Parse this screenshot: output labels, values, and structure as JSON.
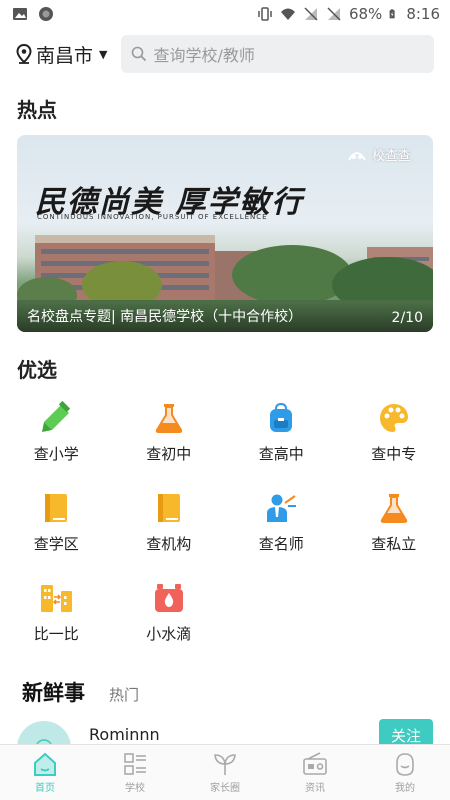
{
  "status": {
    "battery": "68%",
    "time": "8:16"
  },
  "location": {
    "city": "南昌市"
  },
  "search": {
    "placeholder": "查询学校/教师"
  },
  "hot": {
    "title": "热点",
    "banner": {
      "brand": "校查查",
      "calligraphy": "民德尚美 厚学敏行",
      "motto": "CONTINUOUS INNOVATION, PURSUIT OF EXCELLENCE",
      "caption": "名校盘点专题| 南昌民德学校（十中合作校）",
      "pager": "2/10"
    }
  },
  "featured": {
    "title": "优选",
    "items": [
      {
        "label": "查小学",
        "icon": "pencil-icon"
      },
      {
        "label": "查初中",
        "icon": "flask-icon"
      },
      {
        "label": "查高中",
        "icon": "backpack-icon"
      },
      {
        "label": "查中专",
        "icon": "palette-icon"
      },
      {
        "label": "查学区",
        "icon": "book-icon"
      },
      {
        "label": "查机构",
        "icon": "book-icon"
      },
      {
        "label": "查名师",
        "icon": "teacher-icon"
      },
      {
        "label": "查私立",
        "icon": "flask-icon"
      },
      {
        "label": "比一比",
        "icon": "compare-icon"
      },
      {
        "label": "小水滴",
        "icon": "water-drop-icon"
      }
    ]
  },
  "news": {
    "title": "新鲜事",
    "tab_hot": "热门",
    "post": {
      "user": "Rominnn",
      "follow_label": "关注"
    }
  },
  "tabs": [
    {
      "label": "首页",
      "active": true
    },
    {
      "label": "学校",
      "active": false
    },
    {
      "label": "家长圈",
      "active": false
    },
    {
      "label": "资讯",
      "active": false
    },
    {
      "label": "我的",
      "active": false
    }
  ],
  "colors": {
    "accent": "#3ecbc1",
    "orange": "#f58a1f",
    "yellow": "#f7b92b",
    "blue": "#2f9ce8",
    "green": "#5ccc55",
    "red": "#f0625a"
  }
}
